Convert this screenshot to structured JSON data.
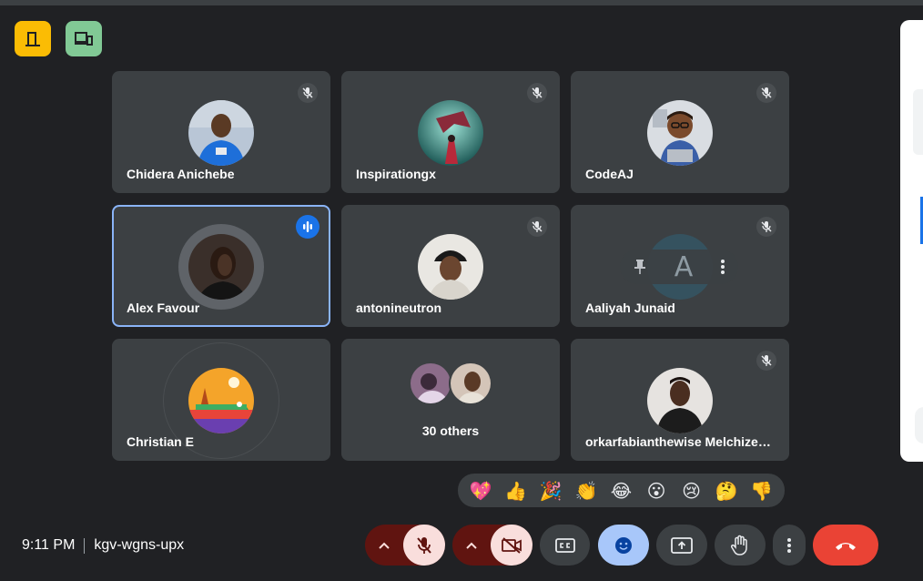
{
  "meeting": {
    "time": "9:11 PM",
    "code": "kgv-wgns-upx"
  },
  "corner_buttons": [
    {
      "icon": "door-icon",
      "color": "#fbbc04"
    },
    {
      "icon": "devices-icon",
      "color": "#81c995"
    }
  ],
  "participants": [
    {
      "name": "Chidera Anichebe",
      "muted": true
    },
    {
      "name": "Inspirationgx",
      "muted": true
    },
    {
      "name": "CodeAJ",
      "muted": true
    },
    {
      "name": "Alex Favour",
      "muted": false,
      "speaking": true
    },
    {
      "name": "antonineutron",
      "muted": true
    },
    {
      "name": "Aaliyah Junaid",
      "muted": true,
      "initial": "A"
    },
    {
      "name": "Christian E",
      "muted": false
    },
    {
      "name": "30 others",
      "muted": false
    },
    {
      "name": "orkarfabianthewise Melchize…",
      "muted": true
    }
  ],
  "reactions": [
    "💖",
    "👍",
    "🎉",
    "👏",
    "😂",
    "😮",
    "😢",
    "🤔",
    "👎"
  ],
  "controls": {
    "mic": "mic-off-icon",
    "camera": "camera-off-icon",
    "captions": "captions-icon",
    "reactions": "emoji-icon",
    "present": "present-icon",
    "raise_hand": "hand-icon",
    "more": "more-vert-icon",
    "leave": "call-end-icon"
  },
  "colors": {
    "background": "#202124",
    "tile": "#3c4043",
    "active_border": "#8ab4f8",
    "leave": "#ea4335",
    "accent_blue": "#1a73e8"
  }
}
